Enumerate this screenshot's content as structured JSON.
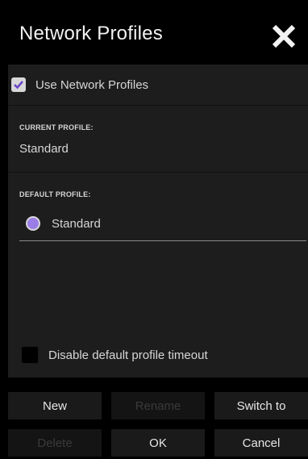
{
  "window": {
    "title": "Network Profiles"
  },
  "use_profiles": {
    "label": "Use Network Profiles",
    "checked": true
  },
  "current_profile": {
    "label": "CURRENT PROFILE:",
    "value": "Standard"
  },
  "default_profile": {
    "label": "DEFAULT PROFILE:",
    "selected": "Standard"
  },
  "disable_timeout": {
    "label": "Disable default profile timeout",
    "checked": false
  },
  "buttons": {
    "new": "New",
    "rename": "Rename",
    "switch_to": "Switch to",
    "delete": "Delete",
    "ok": "OK",
    "cancel": "Cancel"
  },
  "colors": {
    "accent_radio": "#9b7de8",
    "check_mark": "#6a46c9"
  }
}
